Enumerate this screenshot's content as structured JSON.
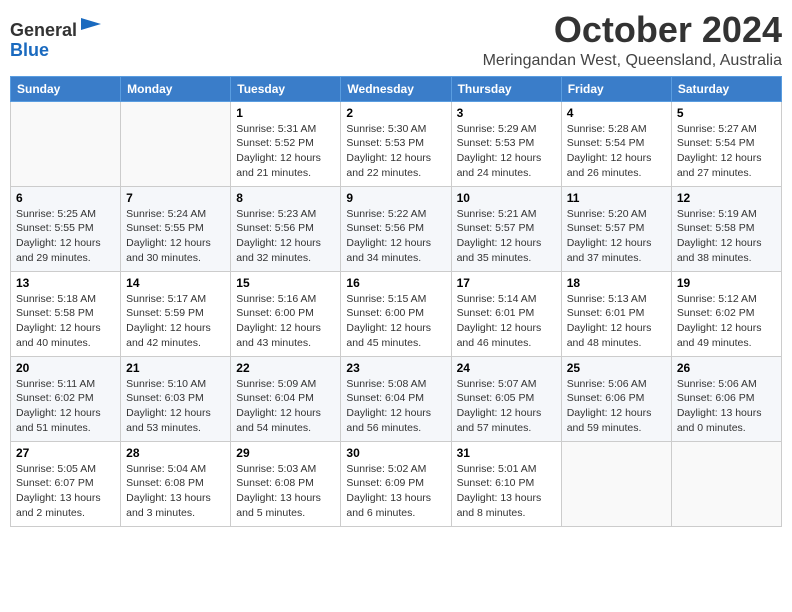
{
  "header": {
    "logo": {
      "line1": "General",
      "line2": "Blue"
    },
    "title": "October 2024",
    "subtitle": "Meringandan West, Queensland, Australia"
  },
  "calendar": {
    "days_of_week": [
      "Sunday",
      "Monday",
      "Tuesday",
      "Wednesday",
      "Thursday",
      "Friday",
      "Saturday"
    ],
    "weeks": [
      [
        {
          "day": "",
          "info": ""
        },
        {
          "day": "",
          "info": ""
        },
        {
          "day": "1",
          "info": "Sunrise: 5:31 AM\nSunset: 5:52 PM\nDaylight: 12 hours and 21 minutes."
        },
        {
          "day": "2",
          "info": "Sunrise: 5:30 AM\nSunset: 5:53 PM\nDaylight: 12 hours and 22 minutes."
        },
        {
          "day": "3",
          "info": "Sunrise: 5:29 AM\nSunset: 5:53 PM\nDaylight: 12 hours and 24 minutes."
        },
        {
          "day": "4",
          "info": "Sunrise: 5:28 AM\nSunset: 5:54 PM\nDaylight: 12 hours and 26 minutes."
        },
        {
          "day": "5",
          "info": "Sunrise: 5:27 AM\nSunset: 5:54 PM\nDaylight: 12 hours and 27 minutes."
        }
      ],
      [
        {
          "day": "6",
          "info": "Sunrise: 5:25 AM\nSunset: 5:55 PM\nDaylight: 12 hours and 29 minutes."
        },
        {
          "day": "7",
          "info": "Sunrise: 5:24 AM\nSunset: 5:55 PM\nDaylight: 12 hours and 30 minutes."
        },
        {
          "day": "8",
          "info": "Sunrise: 5:23 AM\nSunset: 5:56 PM\nDaylight: 12 hours and 32 minutes."
        },
        {
          "day": "9",
          "info": "Sunrise: 5:22 AM\nSunset: 5:56 PM\nDaylight: 12 hours and 34 minutes."
        },
        {
          "day": "10",
          "info": "Sunrise: 5:21 AM\nSunset: 5:57 PM\nDaylight: 12 hours and 35 minutes."
        },
        {
          "day": "11",
          "info": "Sunrise: 5:20 AM\nSunset: 5:57 PM\nDaylight: 12 hours and 37 minutes."
        },
        {
          "day": "12",
          "info": "Sunrise: 5:19 AM\nSunset: 5:58 PM\nDaylight: 12 hours and 38 minutes."
        }
      ],
      [
        {
          "day": "13",
          "info": "Sunrise: 5:18 AM\nSunset: 5:58 PM\nDaylight: 12 hours and 40 minutes."
        },
        {
          "day": "14",
          "info": "Sunrise: 5:17 AM\nSunset: 5:59 PM\nDaylight: 12 hours and 42 minutes."
        },
        {
          "day": "15",
          "info": "Sunrise: 5:16 AM\nSunset: 6:00 PM\nDaylight: 12 hours and 43 minutes."
        },
        {
          "day": "16",
          "info": "Sunrise: 5:15 AM\nSunset: 6:00 PM\nDaylight: 12 hours and 45 minutes."
        },
        {
          "day": "17",
          "info": "Sunrise: 5:14 AM\nSunset: 6:01 PM\nDaylight: 12 hours and 46 minutes."
        },
        {
          "day": "18",
          "info": "Sunrise: 5:13 AM\nSunset: 6:01 PM\nDaylight: 12 hours and 48 minutes."
        },
        {
          "day": "19",
          "info": "Sunrise: 5:12 AM\nSunset: 6:02 PM\nDaylight: 12 hours and 49 minutes."
        }
      ],
      [
        {
          "day": "20",
          "info": "Sunrise: 5:11 AM\nSunset: 6:02 PM\nDaylight: 12 hours and 51 minutes."
        },
        {
          "day": "21",
          "info": "Sunrise: 5:10 AM\nSunset: 6:03 PM\nDaylight: 12 hours and 53 minutes."
        },
        {
          "day": "22",
          "info": "Sunrise: 5:09 AM\nSunset: 6:04 PM\nDaylight: 12 hours and 54 minutes."
        },
        {
          "day": "23",
          "info": "Sunrise: 5:08 AM\nSunset: 6:04 PM\nDaylight: 12 hours and 56 minutes."
        },
        {
          "day": "24",
          "info": "Sunrise: 5:07 AM\nSunset: 6:05 PM\nDaylight: 12 hours and 57 minutes."
        },
        {
          "day": "25",
          "info": "Sunrise: 5:06 AM\nSunset: 6:06 PM\nDaylight: 12 hours and 59 minutes."
        },
        {
          "day": "26",
          "info": "Sunrise: 5:06 AM\nSunset: 6:06 PM\nDaylight: 13 hours and 0 minutes."
        }
      ],
      [
        {
          "day": "27",
          "info": "Sunrise: 5:05 AM\nSunset: 6:07 PM\nDaylight: 13 hours and 2 minutes."
        },
        {
          "day": "28",
          "info": "Sunrise: 5:04 AM\nSunset: 6:08 PM\nDaylight: 13 hours and 3 minutes."
        },
        {
          "day": "29",
          "info": "Sunrise: 5:03 AM\nSunset: 6:08 PM\nDaylight: 13 hours and 5 minutes."
        },
        {
          "day": "30",
          "info": "Sunrise: 5:02 AM\nSunset: 6:09 PM\nDaylight: 13 hours and 6 minutes."
        },
        {
          "day": "31",
          "info": "Sunrise: 5:01 AM\nSunset: 6:10 PM\nDaylight: 13 hours and 8 minutes."
        },
        {
          "day": "",
          "info": ""
        },
        {
          "day": "",
          "info": ""
        }
      ]
    ]
  }
}
